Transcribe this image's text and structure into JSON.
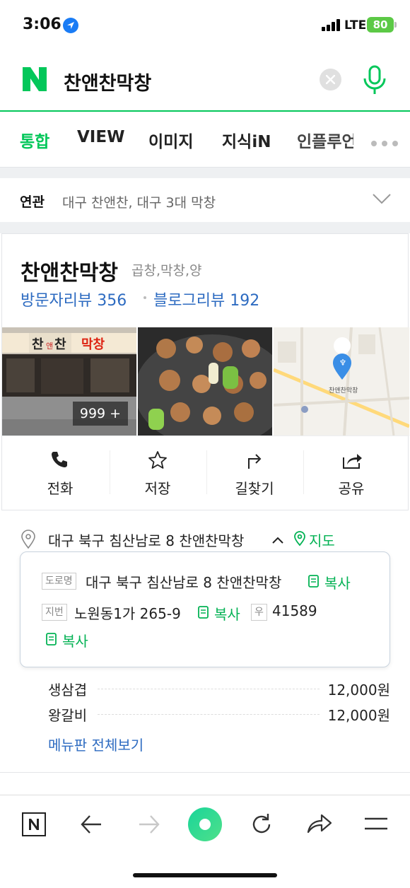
{
  "status": {
    "time": "3:06",
    "network": "LTE",
    "battery": "80"
  },
  "search": {
    "query": "찬앤찬막창"
  },
  "tabs": [
    {
      "label": "통합"
    },
    {
      "label": "VIEW"
    },
    {
      "label": "이미지"
    },
    {
      "label": "지식iN"
    },
    {
      "label": "인플루언"
    }
  ],
  "related": {
    "label": "연관",
    "text": "대구 찬앤찬, 대구 3대 막창"
  },
  "place": {
    "name": "찬앤찬막창",
    "category": "곱창,막창,양",
    "visitor_reviews": "방문자리뷰 356",
    "blog_reviews": "블로그리뷰 192",
    "photo_count": "999 +",
    "map_label": "찬앤찬막창",
    "actions": [
      {
        "label": "전화",
        "icon": "phone-icon"
      },
      {
        "label": "저장",
        "icon": "star-icon"
      },
      {
        "label": "길찾기",
        "icon": "directions-icon"
      },
      {
        "label": "공유",
        "icon": "share-icon"
      }
    ]
  },
  "address": {
    "summary": "대구 북구 침산남로 8 찬앤찬막창",
    "map_link": "지도",
    "road_tag": "도로명",
    "road": "대구 북구 침산남로 8 찬앤찬막창",
    "lot_tag": "지번",
    "lot": "노원동1가 265-9",
    "zip_tag": "우",
    "zip": "41589",
    "copy": "복사"
  },
  "menu": {
    "items": [
      {
        "name": "생삼겹",
        "price": "12,000원"
      },
      {
        "name": "왕갈비",
        "price": "12,000원"
      }
    ],
    "view_all": "메뉴판 전체보기"
  },
  "colors": {
    "accent": "#03c75a",
    "link": "#2d6bc1"
  }
}
